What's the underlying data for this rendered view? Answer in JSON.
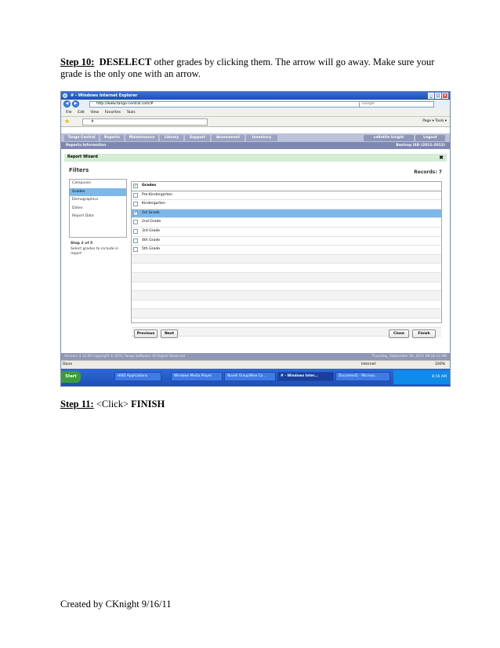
{
  "doc": {
    "step10": {
      "label": "Step 10:",
      "bold": "DESELECT",
      "text": " other grades by clicking them.  The arrow will go away.  Make sure your grade is the only one with an arrow."
    },
    "step11": {
      "label": "Step 11:",
      "text": "  <Click> ",
      "bold": "FINISH"
    },
    "footer": "Created by CKnight 9/16/11"
  },
  "screenshot": {
    "window_title": "# - Windows Internet Explorer",
    "url": "http://www.tango-central.com/#",
    "search_placeholder": "Google",
    "menu": [
      "File",
      "Edit",
      "View",
      "Favorites",
      "Tools"
    ],
    "tab_title": "#",
    "toolbar_tools": "Page ▾  Tools ▾",
    "app_tabs": [
      "Tango Central",
      "Reports",
      "Maintenance",
      "Library",
      "Support",
      "Assessment",
      "Inventory"
    ],
    "user": "cellottie knight",
    "logout": "Logout",
    "report_info": "Reports Information",
    "district": "Bastrop ISD (2011-2012)",
    "wizard_title": "Report Wizard",
    "filters_title": "Filters",
    "records": "Records: 7",
    "sidebar": [
      "Campuses",
      "Grades",
      "Demographics",
      "Dates",
      "Report Data"
    ],
    "sidebar_selected": 1,
    "step_title": "Step 2 of 5",
    "step_text": "Select grades to include in report",
    "grid_header": "Grades",
    "grades": [
      {
        "label": "Pre-Kindergarten",
        "checked": false
      },
      {
        "label": "Kindergarten",
        "checked": false
      },
      {
        "label": "1st Grade",
        "checked": true
      },
      {
        "label": "2nd Grade",
        "checked": false
      },
      {
        "label": "3rd Grade",
        "checked": false
      },
      {
        "label": "4th Grade",
        "checked": false
      },
      {
        "label": "5th Grade",
        "checked": false
      }
    ],
    "buttons": {
      "previous": "Previous",
      "next": "Next",
      "close": "Close",
      "finish": "Finish"
    },
    "app_status_left": "Version: 4.12.00   Copyright © 2011 Tango Software. All Rights Reserved",
    "app_status_right": "Thursday, September 16, 2011 08:16:12 AM",
    "ie_status_left": "Done",
    "ie_zone": "Internet",
    "ie_zoom": "100%",
    "start": "Start",
    "taskbar": [
      "HISD Applications",
      "Windows Media Player",
      "Novell GroupWise Ca...",
      "# - Windows Inter...",
      "Document1 - Microso..."
    ],
    "taskbar_active": 3,
    "clock": "8:16 AM"
  }
}
